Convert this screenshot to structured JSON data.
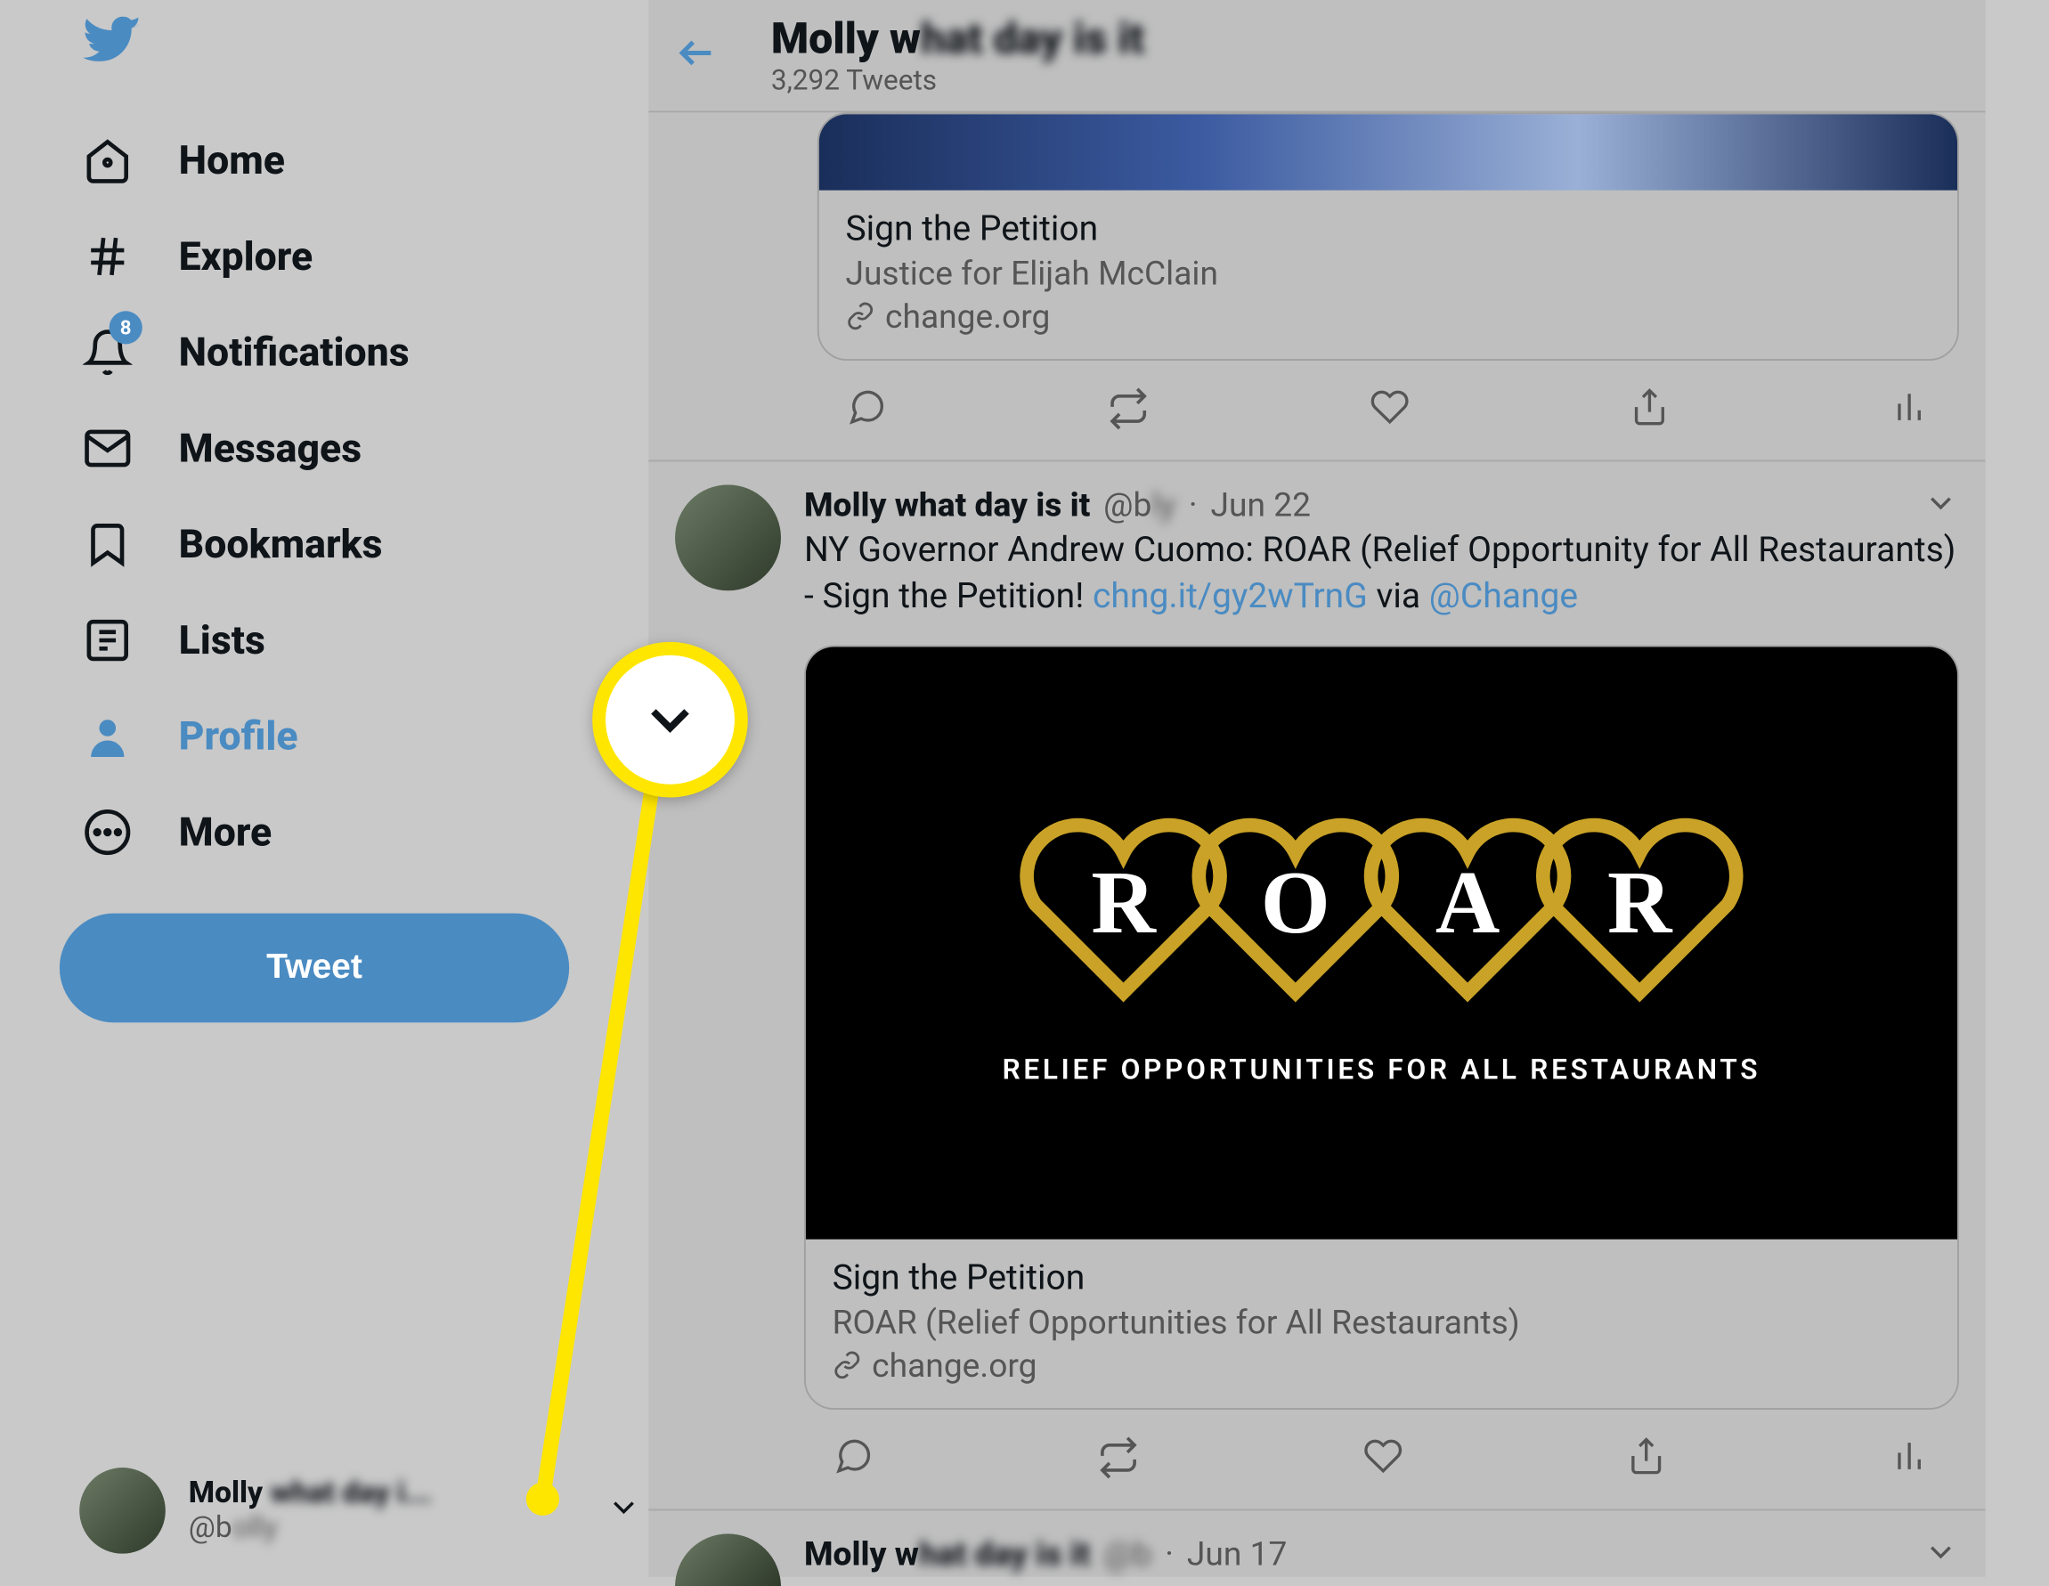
{
  "sidebar": {
    "items": [
      {
        "label": "Home"
      },
      {
        "label": "Explore"
      },
      {
        "label": "Notifications",
        "badge": "8"
      },
      {
        "label": "Messages"
      },
      {
        "label": "Bookmarks"
      },
      {
        "label": "Lists"
      },
      {
        "label": "Profile"
      },
      {
        "label": "More"
      }
    ],
    "tweet_button": "Tweet"
  },
  "account": {
    "display_name": "Molly",
    "display_name_rest": "what day i...",
    "handle_prefix": "@b",
    "handle_rest": "olly"
  },
  "header": {
    "name_prefix": "Molly w",
    "name_rest": "hat day is it",
    "tweet_count": "3,292 Tweets"
  },
  "card1": {
    "title": "Sign the Petition",
    "subtitle": "Justice for Elijah McClain",
    "domain": "change.org"
  },
  "tweet2": {
    "author": "Molly what day is it",
    "handle_prefix": "@b",
    "handle_rest": "ly",
    "date": "Jun 22",
    "text_pre": "NY Governor Andrew Cuomo: ROAR (Relief Opportunity for All Restaurants) - Sign the Petition! ",
    "link1": "chng.it/gy2wTrnG",
    "text_mid": " via ",
    "link2": "@Change",
    "card": {
      "title": "Sign the Petition",
      "subtitle": "ROAR (Relief Opportunities for All Restaurants)",
      "domain": "change.org",
      "logo_tagline": "RELIEF OPPORTUNITIES FOR ALL RESTAURANTS",
      "letters": [
        "R",
        "O",
        "A",
        "R"
      ]
    }
  },
  "tweet3": {
    "author_prefix": "Molly w",
    "date": "Jun 17"
  }
}
